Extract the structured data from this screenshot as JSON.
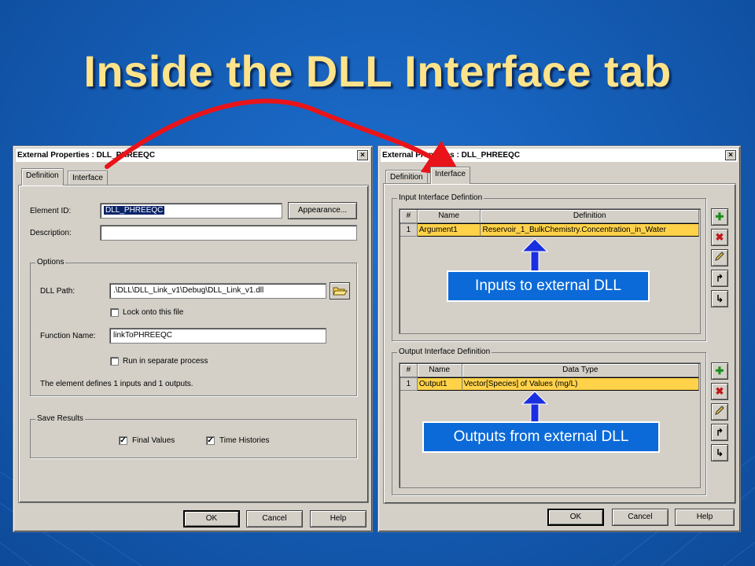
{
  "slide": {
    "title": "Inside the DLL Interface tab"
  },
  "left_dialog": {
    "title": "External Properties : DLL_PHREEQC",
    "close_label": "×",
    "tabs": [
      {
        "label": "Definition",
        "active": true
      },
      {
        "label": "Interface",
        "active": false
      }
    ],
    "element_id_label": "Element ID:",
    "element_id_value": "DLL_PHREEQC",
    "appearance_button": "Appearance...",
    "description_label": "Description:",
    "description_value": "",
    "options_group": "Options",
    "dll_path_label": "DLL Path:",
    "dll_path_value": ".\\DLL\\DLL_Link_v1\\Debug\\DLL_Link_v1.dll",
    "lock_file_label": "Lock onto this file",
    "lock_file_checked": false,
    "function_name_label": "Function Name:",
    "function_name_value": "linkToPHREEQC",
    "separate_process_label": "Run in separate process",
    "separate_process_checked": false,
    "summary_text": "The element defines 1 inputs and 1 outputs.",
    "save_results_group": "Save Results",
    "final_values_label": "Final Values",
    "final_values_checked": true,
    "time_histories_label": "Time Histories",
    "time_histories_checked": true,
    "ok_button": "OK",
    "cancel_button": "Cancel",
    "help_button": "Help"
  },
  "right_dialog": {
    "title": "External Properties : DLL_PHREEQC",
    "close_label": "×",
    "tabs": [
      {
        "label": "Definition",
        "active": false
      },
      {
        "label": "Interface",
        "active": true
      }
    ],
    "input_group": "Input Interface Defintion",
    "input_columns": [
      "#",
      "Name",
      "Definition"
    ],
    "input_rows": [
      {
        "num": "1",
        "name": "Argument1",
        "value": "Reservoir_1_BulkChemistry.Concentration_in_Water"
      }
    ],
    "output_group": "Output Interface Definition",
    "output_columns": [
      "#",
      "Name",
      "Data Type"
    ],
    "output_rows": [
      {
        "num": "1",
        "name": "Output1",
        "value": "Vector[Species] of Values (mg/L)"
      }
    ],
    "tool_icons": [
      "plus-icon",
      "delete-x-icon",
      "edit-pencil-icon",
      "move-up-icon",
      "move-down-icon"
    ],
    "ok_button": "OK",
    "cancel_button": "Cancel",
    "help_button": "Help"
  },
  "callouts": {
    "inputs": "Inputs to external DLL",
    "outputs": "Outputs from external DLL"
  },
  "colors": {
    "background": "#155fb8",
    "title": "#ffe38a",
    "callout": "#0b6ad8",
    "arrow_red": "#e8141a",
    "arrow_blue": "#1a2fe0",
    "selected_row": "#ffd24a"
  }
}
